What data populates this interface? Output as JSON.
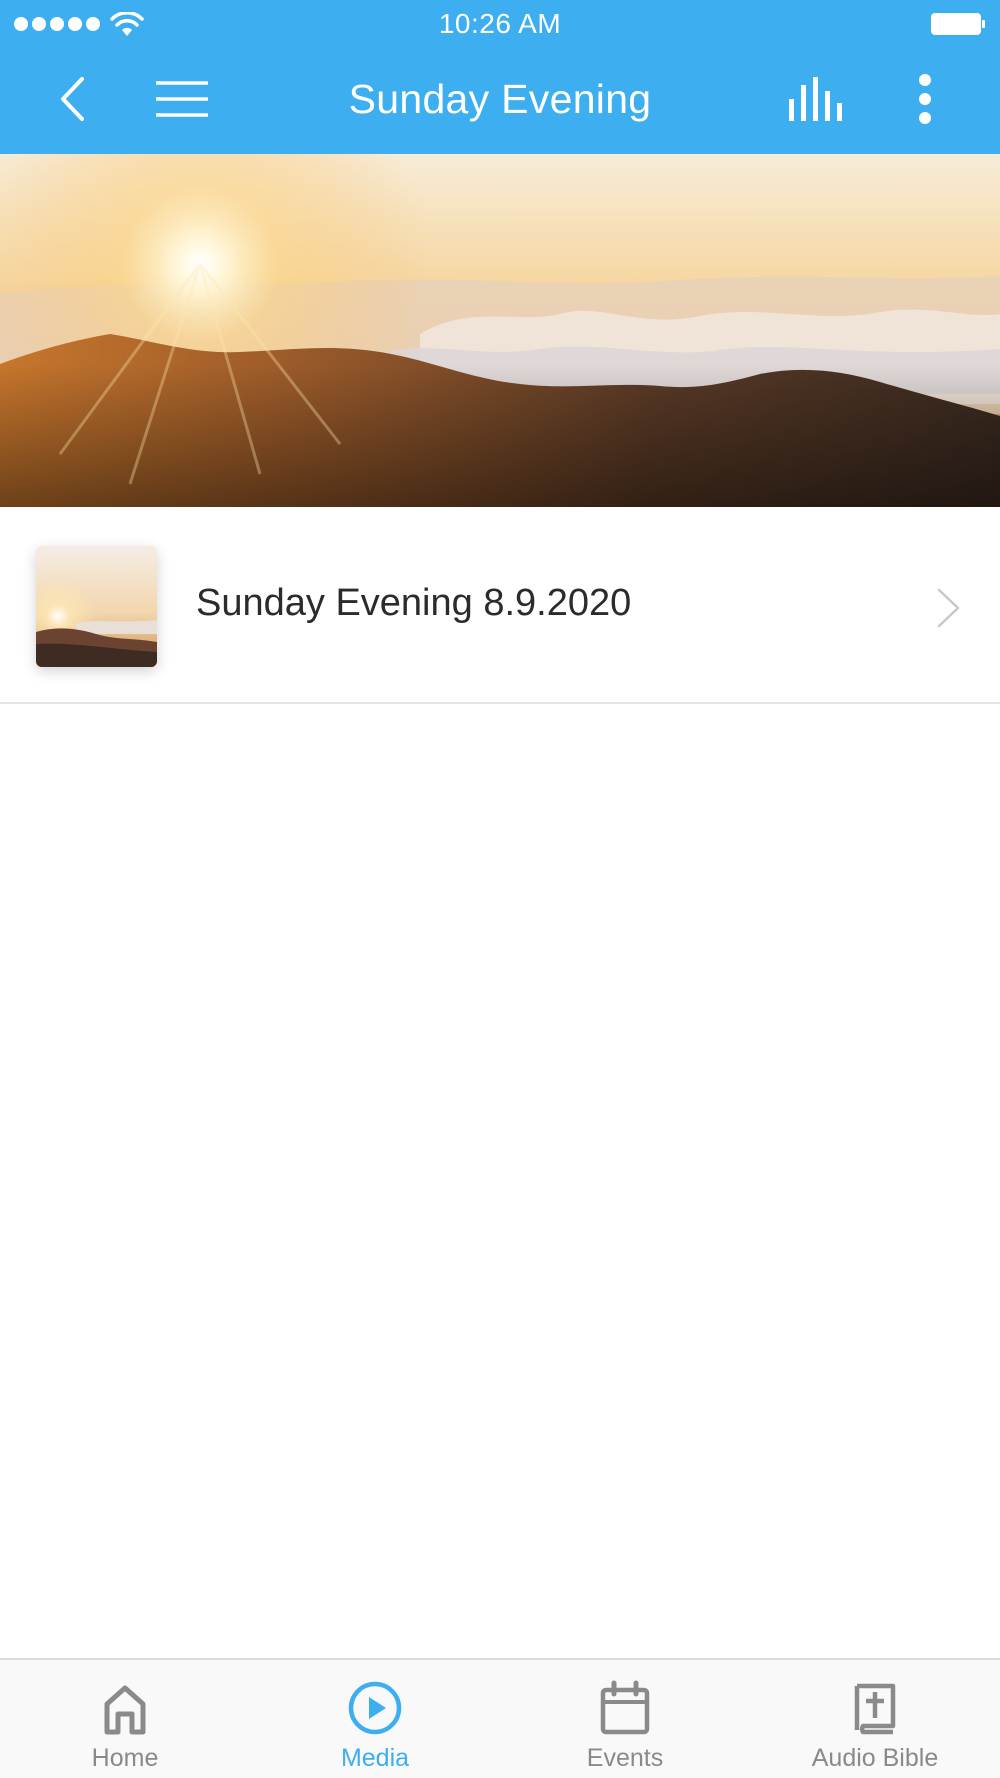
{
  "status_bar": {
    "time": "10:26 AM"
  },
  "nav": {
    "title": "Sunday Evening",
    "icons": [
      "back-icon",
      "menu-icon",
      "audio-bars-icon",
      "more-vertical-icon"
    ]
  },
  "list": {
    "items": [
      {
        "title": "Sunday Evening 8.9.2020"
      }
    ]
  },
  "tabs": [
    {
      "label": "Home",
      "icon": "home-icon",
      "active": false
    },
    {
      "label": "Media",
      "icon": "play-circle-icon",
      "active": true
    },
    {
      "label": "Events",
      "icon": "calendar-icon",
      "active": false
    },
    {
      "label": "Audio Bible",
      "icon": "bible-icon",
      "active": false
    }
  ],
  "colors": {
    "accent": "#3daef0",
    "inactive_tab": "#8a8a8a",
    "text": "#2b2b2b"
  }
}
